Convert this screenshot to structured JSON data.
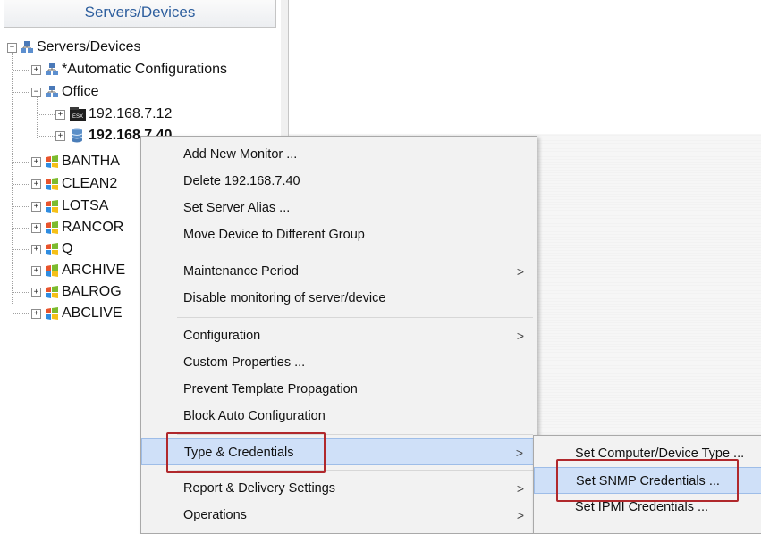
{
  "panel": {
    "header": "Servers/Devices",
    "tree": [
      {
        "label": "Servers/Devices",
        "icon": "network-group-icon",
        "expanded": true
      },
      {
        "label": "*Automatic Configurations",
        "icon": "network-group-icon"
      },
      {
        "label": "Office",
        "icon": "network-group-icon",
        "expanded": true
      },
      {
        "label": "192.168.7.12",
        "icon": "esx-server-icon"
      },
      {
        "label": "192.168.7.40",
        "icon": "database-server-icon",
        "selected": true
      },
      {
        "label": "BANTHA",
        "icon": "windows-server-icon"
      },
      {
        "label": "CLEAN2",
        "icon": "windows-server-icon"
      },
      {
        "label": "LOTSA",
        "icon": "windows-server-icon"
      },
      {
        "label": "RANCOR",
        "icon": "windows-server-icon"
      },
      {
        "label": "Q",
        "icon": "windows-server-icon"
      },
      {
        "label": "ARCHIVE",
        "icon": "windows-server-icon"
      },
      {
        "label": "BALROG",
        "icon": "windows-server-icon"
      },
      {
        "label": "ABCLIVE",
        "icon": "windows-server-icon"
      }
    ]
  },
  "context_menu": {
    "items": [
      {
        "label": "Add New Monitor ..."
      },
      {
        "label": "Delete 192.168.7.40"
      },
      {
        "label": "Set Server Alias ..."
      },
      {
        "label": "Move Device to Different Group"
      },
      {
        "label": "Maintenance Period",
        "submenu": true
      },
      {
        "label": "Disable monitoring of server/device"
      },
      {
        "label": "Configuration",
        "submenu": true
      },
      {
        "label": "Custom Properties ..."
      },
      {
        "label": "Prevent Template Propagation"
      },
      {
        "label": "Block Auto Configuration"
      },
      {
        "label": "Type & Credentials",
        "submenu": true,
        "highlighted": true
      },
      {
        "label": "Report & Delivery Settings",
        "submenu": true
      },
      {
        "label": "Operations",
        "submenu": true
      }
    ],
    "submenu_arrow": ">"
  },
  "submenu": {
    "items": [
      {
        "label": "Set Computer/Device Type ..."
      },
      {
        "label": "Set SNMP Credentials ...",
        "highlighted": true
      },
      {
        "label": "Set IPMI Credentials ..."
      }
    ]
  },
  "colors": {
    "header_text": "#2e5f9e",
    "highlight": "#cfe0f8",
    "callout_box": "#b0282c"
  }
}
